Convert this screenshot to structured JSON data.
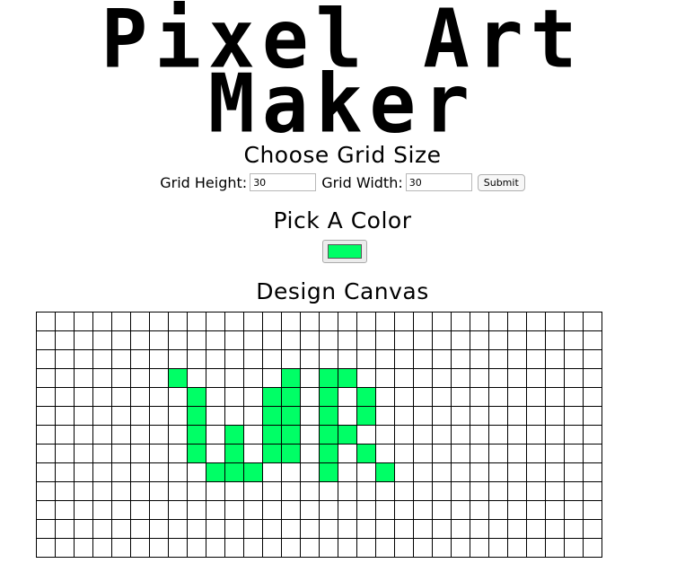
{
  "header": {
    "title_line_1": "Pixel Art",
    "title_line_2": "Maker"
  },
  "grid_form": {
    "heading": "Choose Grid Size",
    "height_label": "Grid Height:",
    "height_value": "30",
    "width_label": "Grid Width:",
    "width_value": "30",
    "submit_label": "Submit"
  },
  "color": {
    "heading": "Pick A Color",
    "value": "#00ff66"
  },
  "canvas": {
    "heading": "Design Canvas",
    "rows": 13,
    "cols": 30,
    "fill_color": "#00ff66",
    "filled_cells": [
      [
        3,
        7
      ],
      [
        3,
        13
      ],
      [
        3,
        15
      ],
      [
        3,
        16
      ],
      [
        4,
        8
      ],
      [
        4,
        12
      ],
      [
        4,
        13
      ],
      [
        4,
        15
      ],
      [
        4,
        17
      ],
      [
        5,
        8
      ],
      [
        5,
        12
      ],
      [
        5,
        13
      ],
      [
        5,
        15
      ],
      [
        5,
        17
      ],
      [
        6,
        8
      ],
      [
        6,
        10
      ],
      [
        6,
        12
      ],
      [
        6,
        13
      ],
      [
        6,
        15
      ],
      [
        6,
        16
      ],
      [
        7,
        8
      ],
      [
        7,
        10
      ],
      [
        7,
        12
      ],
      [
        7,
        13
      ],
      [
        7,
        15
      ],
      [
        7,
        17
      ],
      [
        8,
        9
      ],
      [
        8,
        10
      ],
      [
        8,
        11
      ],
      [
        8,
        15
      ],
      [
        8,
        18
      ]
    ]
  }
}
